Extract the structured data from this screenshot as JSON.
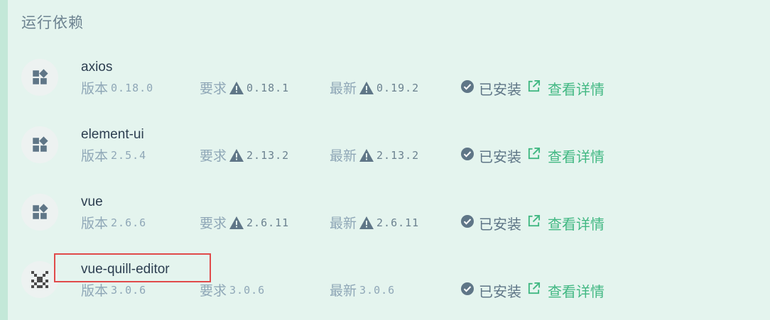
{
  "section": {
    "title": "运行依赖"
  },
  "labels": {
    "version": "版本",
    "required": "要求",
    "latest": "最新",
    "installed": "已安装",
    "details": "查看详情"
  },
  "colors": {
    "accent": "#42b883",
    "warning": "#5f7687",
    "highlight": "#e04a4a"
  },
  "dependencies": [
    {
      "name": "axios",
      "version": "0.18.0",
      "required": "0.18.1",
      "latest": "0.19.2",
      "required_warning": true,
      "latest_warning": true,
      "icon": "widgets-icon"
    },
    {
      "name": "element-ui",
      "version": "2.5.4",
      "required": "2.13.2",
      "latest": "2.13.2",
      "required_warning": true,
      "latest_warning": true,
      "icon": "widgets-icon"
    },
    {
      "name": "vue",
      "version": "2.6.6",
      "required": "2.6.11",
      "latest": "2.6.11",
      "required_warning": true,
      "latest_warning": true,
      "icon": "widgets-icon"
    },
    {
      "name": "vue-quill-editor",
      "version": "3.0.6",
      "required": "3.0.6",
      "latest": "3.0.6",
      "required_warning": false,
      "latest_warning": false,
      "icon": "pixel-logo-icon"
    }
  ]
}
